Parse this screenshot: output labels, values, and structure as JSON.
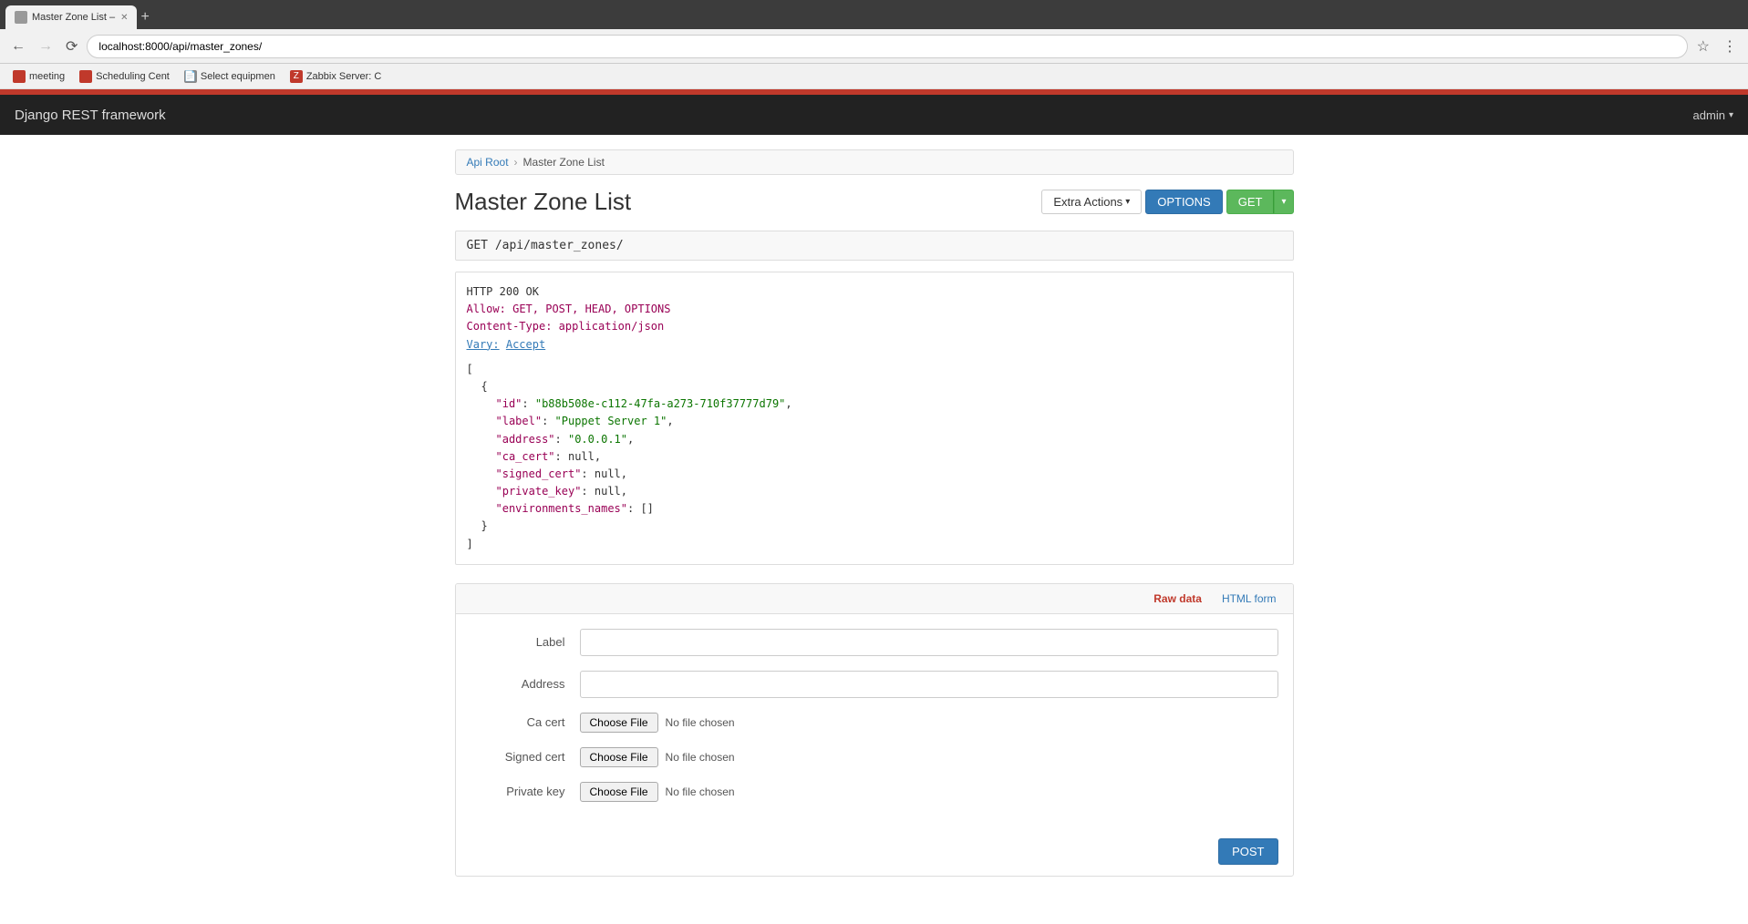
{
  "browser": {
    "tab_title": "Master Zone List –",
    "address": "localhost:8000/api/master_zones/",
    "bookmarks": [
      {
        "label": "meeting",
        "iconColor": "red"
      },
      {
        "label": "Scheduling Cent",
        "iconColor": "red"
      },
      {
        "label": "Select equipmen",
        "iconColor": "gray"
      },
      {
        "label": "Zabbix Server: C",
        "iconColor": "blue"
      }
    ]
  },
  "navbar": {
    "brand": "Django REST framework",
    "admin_label": "admin"
  },
  "breadcrumb": {
    "api_root": "Api Root",
    "current": "Master Zone List"
  },
  "page": {
    "title": "Master Zone List"
  },
  "toolbar": {
    "extra_actions": "Extra Actions",
    "options_btn": "OPTIONS",
    "get_btn": "GET"
  },
  "request": {
    "method": "GET",
    "path": "/api/master_zones/"
  },
  "response": {
    "status": "HTTP 200 OK",
    "allow_label": "Allow:",
    "allow_methods": "GET, POST, HEAD, OPTIONS",
    "content_type_label": "Content-Type:",
    "content_type_value": "application/json",
    "vary_label": "Vary:",
    "vary_value": "Accept"
  },
  "json_data": {
    "id_key": "\"id\"",
    "id_value": "\"b88b508e-c112-47fa-a273-710f37777d79\"",
    "label_key": "\"label\"",
    "label_value": "\"Puppet Server 1\"",
    "address_key": "\"address\"",
    "address_value": "\"0.0.0.1\"",
    "ca_cert_key": "\"ca_cert\"",
    "ca_cert_value": "null",
    "signed_cert_key": "\"signed_cert\"",
    "signed_cert_value": "null",
    "private_key_key": "\"private_key\"",
    "private_key_value": "null",
    "environments_names_key": "\"environments_names\"",
    "environments_names_value": "[]"
  },
  "form": {
    "raw_data_tab": "Raw data",
    "html_form_tab": "HTML form",
    "label_field": "Label",
    "address_field": "Address",
    "ca_cert_field": "Ca cert",
    "signed_cert_field": "Signed cert",
    "private_key_field": "Private key",
    "choose_file_btn": "Choose File",
    "no_file_chosen": "No file chosen",
    "post_btn": "POST"
  }
}
